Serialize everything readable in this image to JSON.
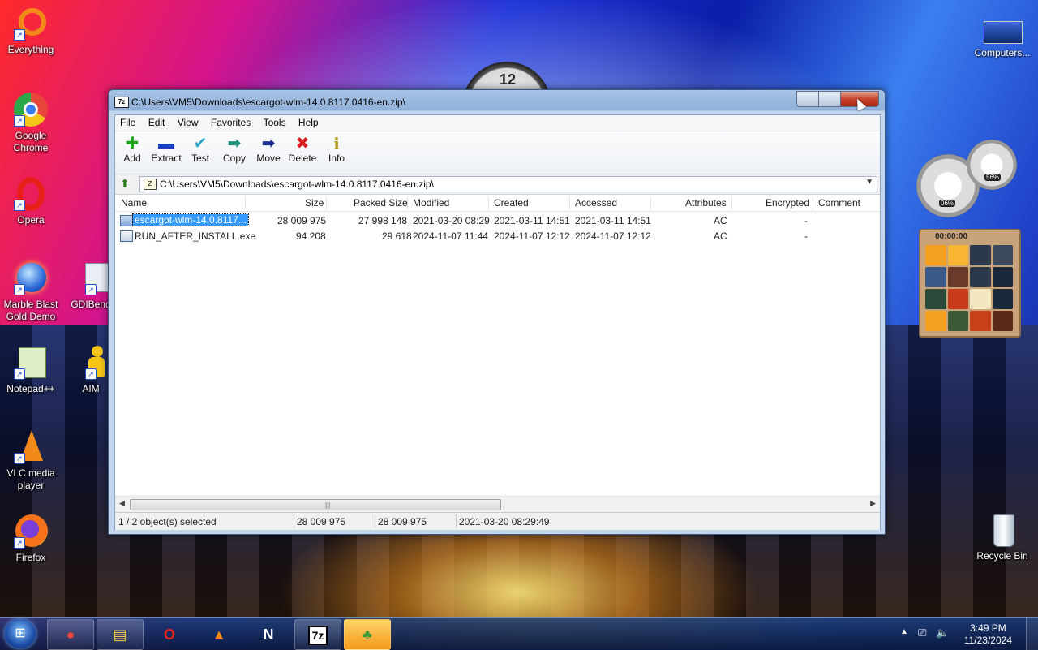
{
  "desktop": {
    "icons": [
      {
        "label": "Everything"
      },
      {
        "label": "Google\nChrome"
      },
      {
        "label": "Opera"
      },
      {
        "label": "Marble Blast\nGold Demo"
      },
      {
        "label": "GDIBend"
      },
      {
        "label": "Notepad++"
      },
      {
        "label": "AIM"
      },
      {
        "label": "VLC media\nplayer"
      },
      {
        "label": "Firefox"
      },
      {
        "label": "Computers..."
      },
      {
        "label": "Recycle Bin"
      }
    ],
    "meter": {
      "cpu": "06%",
      "ram": "56%"
    },
    "puzzle": {
      "timer": "00:00:00"
    },
    "clock_gadget": {
      "label": "12"
    }
  },
  "window": {
    "title": "C:\\Users\\VM5\\Downloads\\escargot-wlm-14.0.8117.0416-en.zip\\",
    "app_icon": "7z",
    "menu": [
      "File",
      "Edit",
      "View",
      "Favorites",
      "Tools",
      "Help"
    ],
    "toolbar": [
      {
        "label": "Add",
        "icon": "plus-icon",
        "glyph": "✚",
        "color": "#1fa31f"
      },
      {
        "label": "Extract",
        "icon": "minus-icon",
        "glyph": "▬",
        "color": "#1a3fc2"
      },
      {
        "label": "Test",
        "icon": "check-icon",
        "glyph": "✔",
        "color": "#2aa8c8"
      },
      {
        "label": "Copy",
        "icon": "copy-arrow-icon",
        "glyph": "➡",
        "color": "#1f8f7a"
      },
      {
        "label": "Move",
        "icon": "move-arrow-icon",
        "glyph": "➡",
        "color": "#1a2f90"
      },
      {
        "label": "Delete",
        "icon": "delete-x-icon",
        "glyph": "✖",
        "color": "#d81e1e"
      },
      {
        "label": "Info",
        "icon": "info-icon",
        "glyph": "i",
        "color": "#b59a12"
      }
    ],
    "address": "C:\\Users\\VM5\\Downloads\\escargot-wlm-14.0.8117.0416-en.zip\\",
    "columns": [
      "Name",
      "Size",
      "Packed Size",
      "Modified",
      "Created",
      "Accessed",
      "Attributes",
      "Encrypted",
      "Comment"
    ],
    "rows": [
      {
        "name": "escargot-wlm-14.0.8117...",
        "size": "28 009 975",
        "packed": "27 998 148",
        "modified": "2021-03-20 08:29",
        "created": "2021-03-11 14:51",
        "accessed": "2021-03-11 14:51",
        "attributes": "AC",
        "encrypted": "-",
        "comment": "",
        "selected": true
      },
      {
        "name": "RUN_AFTER_INSTALL.exe",
        "size": "94 208",
        "packed": "29 618",
        "modified": "2024-11-07 11:44",
        "created": "2024-11-07 12:12",
        "accessed": "2024-11-07 12:12",
        "attributes": "AC",
        "encrypted": "-",
        "comment": "",
        "selected": false
      }
    ],
    "status": {
      "selection": "1 / 2 object(s) selected",
      "size": "28 009 975",
      "packed": "28 009 975",
      "modified": "2021-03-20 08:29:49"
    }
  },
  "taskbar": {
    "buttons": [
      {
        "name": "chrome",
        "glyph": "●",
        "color": "#e8453c"
      },
      {
        "name": "explorer",
        "glyph": "▤",
        "color": "#f2c94c"
      },
      {
        "name": "opera",
        "glyph": "O",
        "color": "#e8201a"
      },
      {
        "name": "vlc",
        "glyph": "▲",
        "color": "#f28a1a"
      },
      {
        "name": "netscape",
        "glyph": "N",
        "color": "#ffffff"
      },
      {
        "name": "7zip",
        "glyph": "7z",
        "color": "#000000"
      },
      {
        "name": "users",
        "glyph": "♣",
        "color": "#3a9a3a"
      }
    ],
    "time": "3:49 PM",
    "date": "11/23/2024"
  }
}
